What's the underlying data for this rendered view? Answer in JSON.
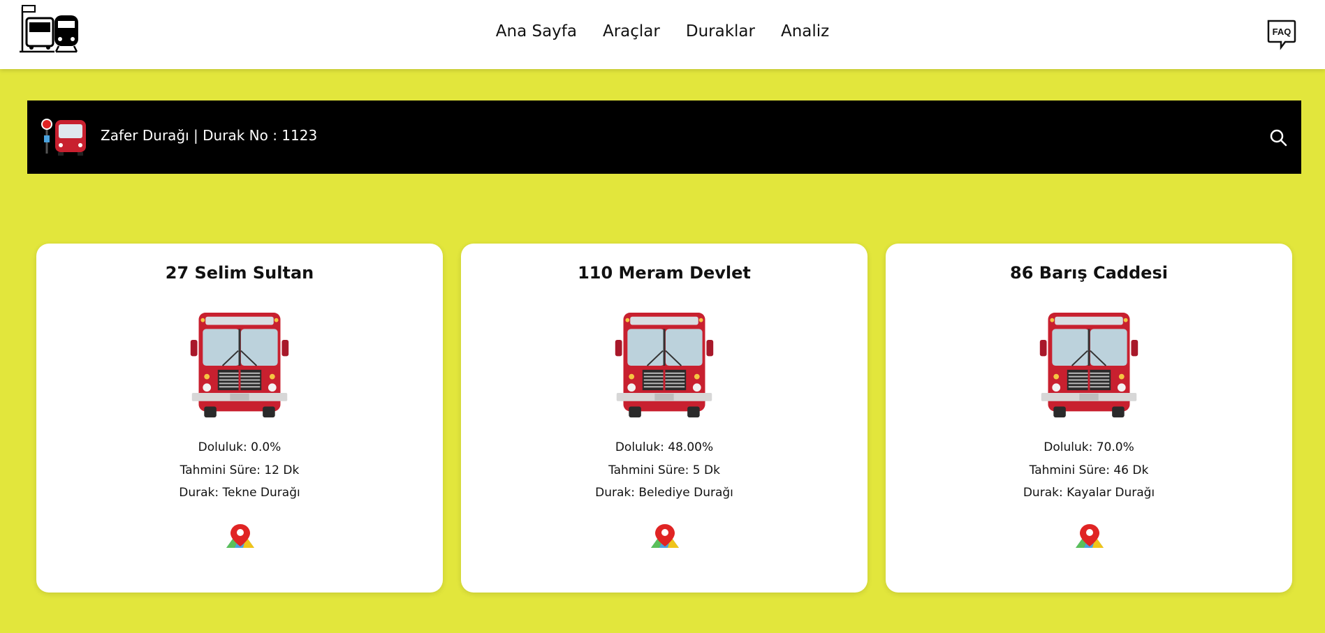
{
  "header": {
    "logo_icon": "bus-train-station-icon",
    "nav": [
      {
        "label": "Ana Sayfa"
      },
      {
        "label": "Araçlar"
      },
      {
        "label": "Duraklar"
      },
      {
        "label": "Analiz"
      }
    ],
    "faq_icon": "faq-speech-bubble-icon",
    "faq_label": "FAQ"
  },
  "stop": {
    "icon": "bus-stop-icon",
    "title": "Zafer Durağı | Durak No : 1123",
    "search_icon": "search-icon"
  },
  "colors": {
    "background": "#e2e63c",
    "bus_red": "#c8202f",
    "bar": "#000000"
  },
  "cards": [
    {
      "title": "27 Selim Sultan",
      "doluluk": "Doluluk: 0.0%",
      "sure": "Tahmini Süre: 12 Dk",
      "durak": "Durak: Tekne Durağı"
    },
    {
      "title": "110 Meram Devlet",
      "doluluk": "Doluluk: 48.00%",
      "sure": "Tahmini Süre: 5 Dk",
      "durak": "Durak: Belediye Durağı"
    },
    {
      "title": "86 Barış Caddesi",
      "doluluk": "Doluluk: 70.0%",
      "sure": "Tahmini Süre: 46 Dk",
      "durak": "Durak: Kayalar Durağı"
    }
  ]
}
